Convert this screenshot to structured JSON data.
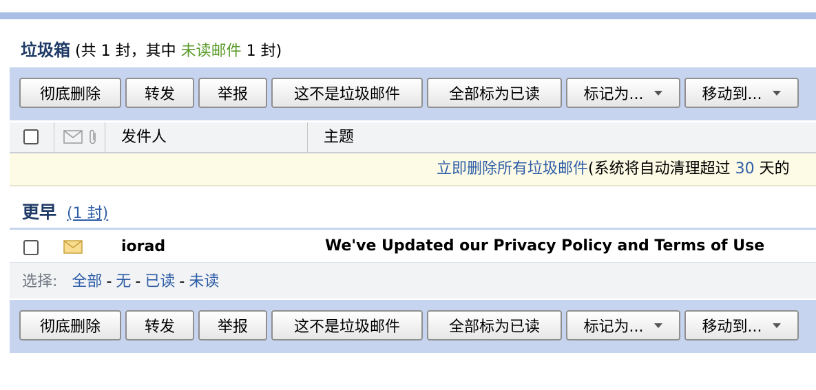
{
  "folder": {
    "name": "垃圾箱",
    "count_open": "(共 1 封，其中",
    "unread_label": "未读邮件",
    "count_close": "1 封)"
  },
  "toolbar": {
    "buttons": [
      {
        "label": "彻底删除"
      },
      {
        "label": "转发"
      },
      {
        "label": "举报"
      },
      {
        "label": "这不是垃圾邮件"
      },
      {
        "label": "全部标为已读"
      },
      {
        "label": "标记为..."
      },
      {
        "label": "移动到..."
      }
    ]
  },
  "columns": {
    "sender": "发件人",
    "subject": "主题"
  },
  "notice": {
    "link": "立即删除所有垃圾邮件",
    "text_before": "(系统将自动清理超过",
    "days": "30",
    "text_after": "天的"
  },
  "group": {
    "name": "更早",
    "count": "(1 封)"
  },
  "messages": [
    {
      "sender": "iorad",
      "subject": "We've Updated our Privacy Policy and Terms of Use"
    }
  ],
  "select": {
    "label": "选择:",
    "all": "全部",
    "none": "无",
    "read": "已读",
    "unread": "未读"
  },
  "colors": {
    "accent": "#2f5ea8",
    "toolbar_bg": "#c6d4ef",
    "unread": "#5a9b29",
    "notice_bg": "#fdfbe5"
  }
}
